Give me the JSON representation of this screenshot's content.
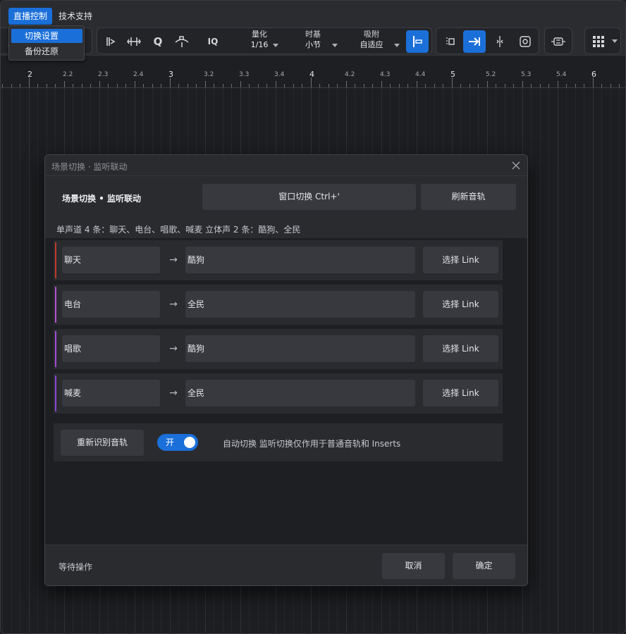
{
  "menubar": {
    "items": [
      "直播控制",
      "技术支持"
    ],
    "dropdown": [
      "切换设置",
      "备份还原"
    ]
  },
  "toolbar": {
    "quantize": {
      "label": "量化",
      "value": "1/16"
    },
    "timebase": {
      "label": "时基",
      "value": "小节"
    },
    "snap": {
      "label": "吸附",
      "value": "自适应"
    },
    "iq_label": "IQ",
    "q_label": "Q"
  },
  "ruler": {
    "majors": [
      "2",
      "3",
      "4",
      "5",
      "6"
    ],
    "minors": [
      "2.2",
      "2.3",
      "2.4",
      "3.2",
      "3.3",
      "3.4",
      "4.2",
      "4.3",
      "4.4",
      "5.2",
      "5.3",
      "5.4"
    ]
  },
  "dialog": {
    "window_title": "场景切换 · 监听联动",
    "heading": "场景切换 • 监听联动",
    "window_switch_button": "窗口切换  Ctrl+'",
    "refresh_button": "刷新音轨",
    "summary": "单声道 4 条：聊天、电台、唱歌、喊麦    立体声 2 条：酷狗、全民",
    "arrow": "→",
    "rows": [
      {
        "source": "聊天",
        "target": "酷狗",
        "action": "选择 Link",
        "accent": "#c0392b"
      },
      {
        "source": "电台",
        "target": "全民",
        "action": "选择 Link",
        "accent": "#b44fd1"
      },
      {
        "source": "唱歌",
        "target": "酷狗",
        "action": "选择 Link",
        "accent": "#a24bd8"
      },
      {
        "source": "喊麦",
        "target": "全民",
        "action": "选择 Link",
        "accent": "#8a45d6"
      }
    ],
    "rescan_button": "重新识别音轨",
    "toggle_label": "开",
    "toggle_on": true,
    "auto_switch_text": "自动切换    监听切换仅作用于普通音轨和 Inserts",
    "status": "等待操作",
    "cancel_button": "取消",
    "ok_button": "确定"
  },
  "colors": {
    "accent": "#1b6fd9",
    "background": "#1e1f22",
    "panel": "#2a2b2f",
    "button": "#37393e"
  }
}
